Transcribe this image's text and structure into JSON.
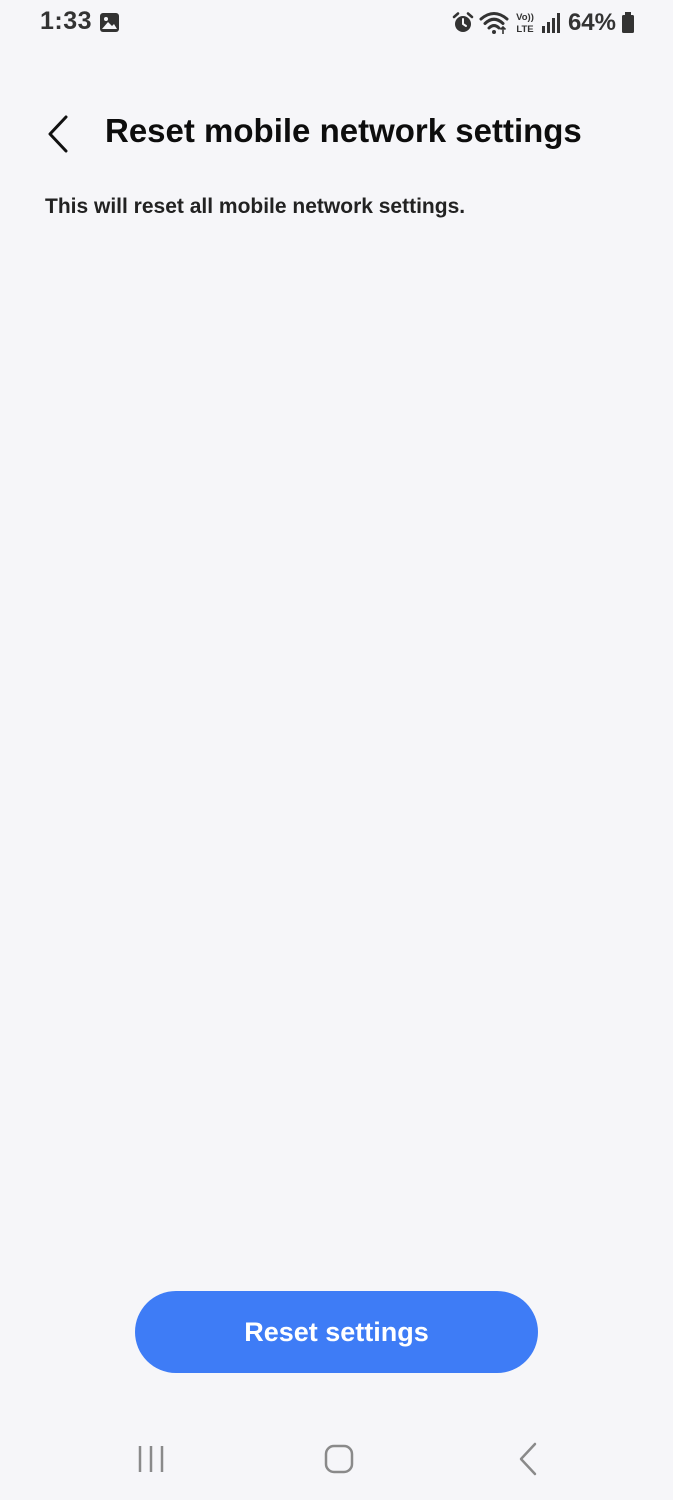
{
  "status_bar": {
    "time": "1:33",
    "battery_percent": "64%",
    "network_label_top": "Vo))",
    "network_label_bottom": "LTE",
    "icons": [
      "gallery-icon",
      "alarm-icon",
      "wifi-icon",
      "volte-icon",
      "signal-icon",
      "battery-icon"
    ]
  },
  "header": {
    "title": "Reset mobile network settings",
    "back_icon": "chevron-left-icon"
  },
  "main": {
    "description": "This will reset all mobile network settings."
  },
  "actions": {
    "reset_label": "Reset settings",
    "reset_color": "#3e7cf6"
  },
  "navigation": {
    "icons": [
      "recents-icon",
      "home-icon",
      "back-icon"
    ]
  },
  "colors": {
    "background": "#f6f6f9",
    "accent": "#3e7cf6",
    "text": "#111111"
  }
}
